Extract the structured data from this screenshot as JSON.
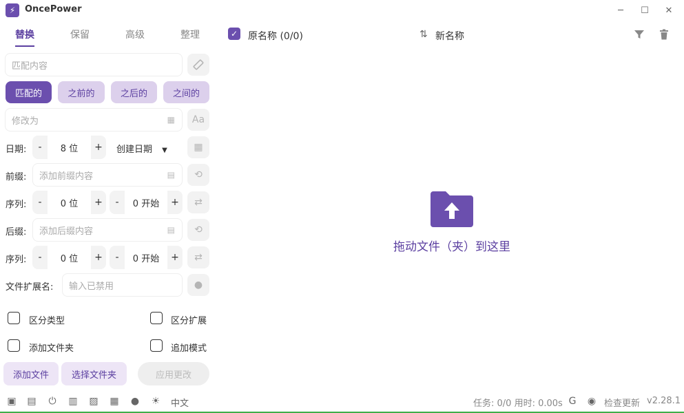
{
  "app": {
    "title": "OncePower",
    "version": "v2.28.1",
    "accent": "#6b4fae"
  },
  "window_controls": [
    "minimize-icon",
    "maximize-icon",
    "close-icon"
  ],
  "tabs": [
    {
      "label": "替换",
      "active": true
    },
    {
      "label": "保留",
      "active": false
    },
    {
      "label": "高级",
      "active": false
    },
    {
      "label": "整理",
      "active": false
    }
  ],
  "match": {
    "placeholder": "匹配内容"
  },
  "match_modes": [
    {
      "label": "匹配的",
      "active": true
    },
    {
      "label": "之前的",
      "active": false
    },
    {
      "label": "之后的",
      "active": false
    },
    {
      "label": "之间的",
      "active": false
    }
  ],
  "replace": {
    "placeholder": "修改为"
  },
  "date": {
    "label": "日期:",
    "digits": "8 位",
    "type": "创建日期"
  },
  "prefix": {
    "label": "前缀:",
    "placeholder": "添加前缀内容"
  },
  "prefix_seq": {
    "label": "序列:",
    "digits": "0 位",
    "start": "0 开始"
  },
  "suffix": {
    "label": "后缀:",
    "placeholder": "添加后缀内容"
  },
  "suffix_seq": {
    "label": "序列:",
    "digits": "0 位",
    "start": "0 开始"
  },
  "extension": {
    "label": "文件扩展名:",
    "placeholder": "输入已禁用"
  },
  "options": {
    "distinguish_type": "区分类型",
    "distinguish_ext": "区分扩展",
    "add_folder": "添加文件夹",
    "append_mode": "追加模式"
  },
  "actions": {
    "add_file": "添加文件",
    "select_folder": "选择文件夹",
    "apply": "应用更改"
  },
  "list_header": {
    "original": "原名称 (0/0)",
    "new_name": "新名称"
  },
  "drop": {
    "text": "拖动文件（夹）到这里"
  },
  "footer": {
    "status": "任务: 0/0 用时: 0.00s",
    "check_update": "检查更新",
    "lang": "中文",
    "icons": [
      "save-icon",
      "log-icon",
      "power-icon",
      "clipboard-icon",
      "image-icon",
      "csv-icon",
      "bulb-icon",
      "sun-icon"
    ]
  }
}
